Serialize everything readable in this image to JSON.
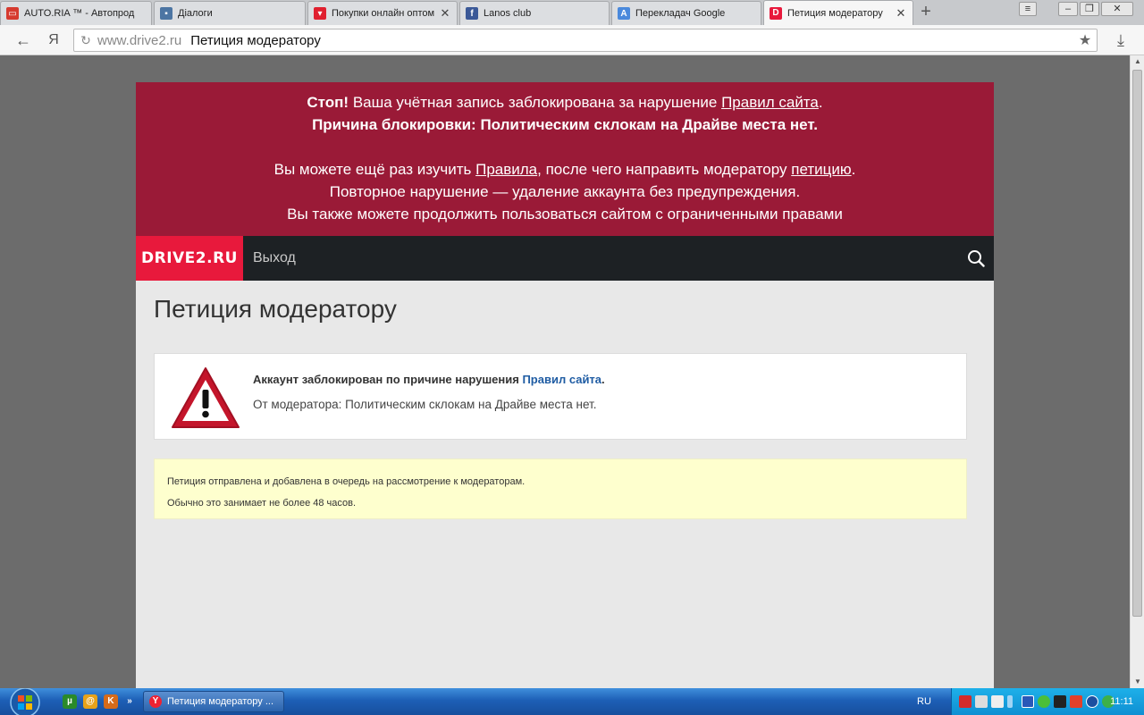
{
  "browser": {
    "tabs": [
      {
        "title": "AUTO.RIA ™ - Автопрод",
        "favicon": "car-icon",
        "color": "#d63a2f",
        "active": false
      },
      {
        "title": "Діалоги",
        "favicon": "chat-icon",
        "color": "#4c75a3",
        "active": false
      },
      {
        "title": "Покупки онлайн оптом",
        "favicon": "cart-icon",
        "color": "#e0202f",
        "active": false
      },
      {
        "title": "Lanos club",
        "favicon": "facebook-icon",
        "color": "#3b5998",
        "active": false
      },
      {
        "title": "Перекладач Google",
        "favicon": "translate-icon",
        "color": "#4a89dc",
        "active": false
      },
      {
        "title": "Петиция модератору",
        "favicon": "drive2-icon",
        "color": "#e8193c",
        "active": true
      }
    ],
    "address": {
      "host": "www.drive2.ru",
      "page_title": "Петиция модератору",
      "yandex_label": "Я"
    }
  },
  "ban_notice": {
    "stop": "Стоп!",
    "line1_text": " Ваша учётная запись заблокирована за нарушение ",
    "line1_link": "Правил сайта",
    "line1_end": ".",
    "line2": "Причина блокировки: Политическим склокам на Драйве места нет.",
    "line3_a": "Вы можете ещё раз изучить ",
    "line3_link1": "Правила",
    "line3_b": ", после чего направить модератору ",
    "line3_link2": "петицию",
    "line3_c": ".",
    "line4": "Повторное нарушение — удаление аккаунта без предупреждения.",
    "line5": "Вы также можете продолжить пользоваться сайтом с ограниченными правами"
  },
  "site_nav": {
    "logo": "DRIVE2.RU",
    "exit_label": "Выход"
  },
  "main": {
    "title": "Петиция модератору",
    "warning": {
      "line1_text": "Аккаунт заблокирован по причине нарушения ",
      "line1_link": "Правил сайта",
      "line1_end": ".",
      "line2": "От модератора: Политическим склокам на Драйве места нет."
    },
    "note": {
      "line1": "Петиция отправлена и добавлена в очередь на рассмотрение к модераторам.",
      "line2": "Обычно это занимает не более 48 часов."
    }
  },
  "taskbar": {
    "task_title": "Петиция модератору ...",
    "lang": "RU",
    "clock": "11:11"
  },
  "colors": {
    "ban_bg": "#9a1a37",
    "logo_bg": "#e8193c",
    "nav_bg": "#1d2124",
    "note_bg": "#feffce",
    "link": "#1f5ca3"
  }
}
